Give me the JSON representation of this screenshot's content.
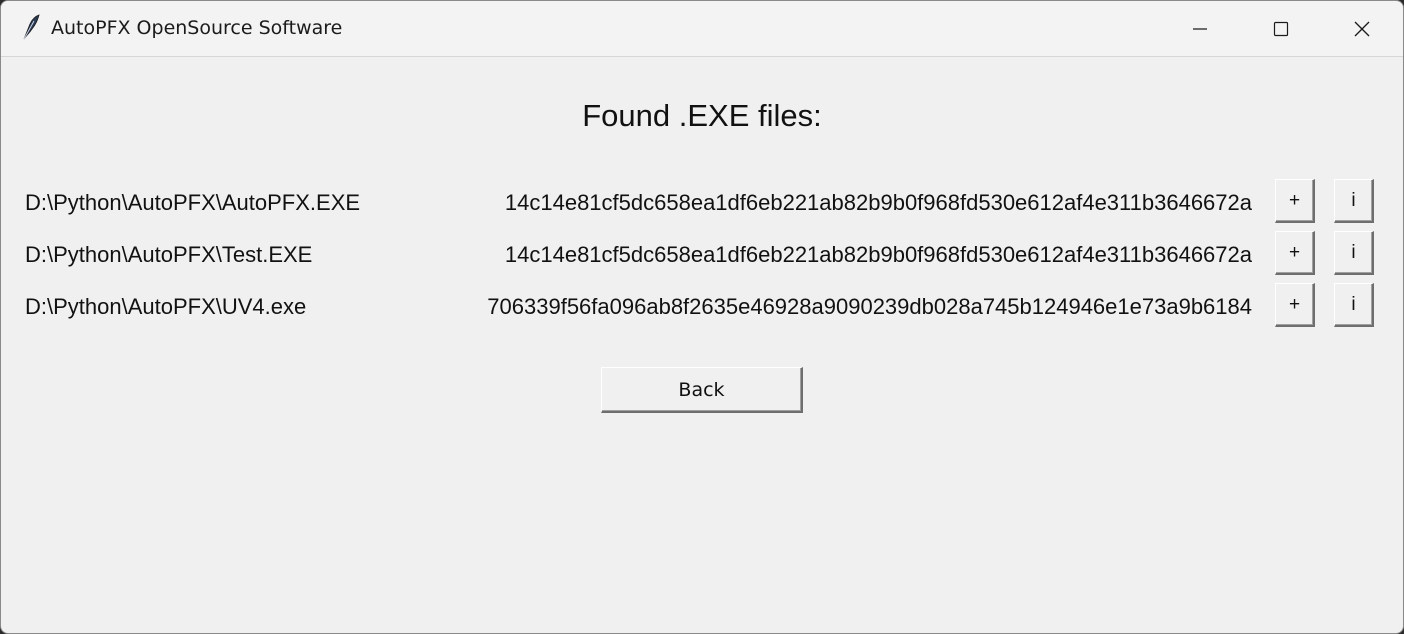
{
  "window": {
    "title": "AutoPFX OpenSource Software",
    "icon": "feather-icon",
    "controls": {
      "minimize_icon": "minimize-icon",
      "maximize_icon": "maximize-icon",
      "close_icon": "close-icon"
    }
  },
  "main": {
    "heading": "Found .EXE files:",
    "files": [
      {
        "path": "D:\\Python\\AutoPFX\\AutoPFX.EXE",
        "hash": "14c14e81cf5dc658ea1df6eb221ab82b9b0f968fd530e612af4e311b3646672a",
        "add_label": "+",
        "info_label": "i"
      },
      {
        "path": "D:\\Python\\AutoPFX\\Test.EXE",
        "hash": "14c14e81cf5dc658ea1df6eb221ab82b9b0f968fd530e612af4e311b3646672a",
        "add_label": "+",
        "info_label": "i"
      },
      {
        "path": "D:\\Python\\AutoPFX\\UV4.exe",
        "hash": "706339f56fa096ab8f2635e46928a9090239db028a745b124946e1e73a9b6184",
        "add_label": "+",
        "info_label": "i"
      }
    ],
    "back_label": "Back"
  }
}
